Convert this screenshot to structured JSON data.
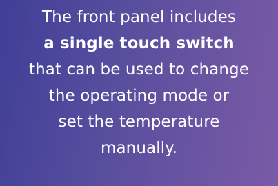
{
  "panel": {
    "lines": [
      {
        "text": "The front panel includes",
        "bold": false
      },
      {
        "text": "a single touch switch",
        "bold": true
      },
      {
        "text": "that can be used to change",
        "bold": false
      },
      {
        "text": "the operating mode or",
        "bold": false
      },
      {
        "text": "set the temperature",
        "bold": false
      },
      {
        "text": "manually.",
        "bold": false
      }
    ]
  },
  "colors": {
    "gradient_start": "#3f3f97",
    "gradient_end": "#7a5aa6",
    "text": "#ffffff"
  }
}
